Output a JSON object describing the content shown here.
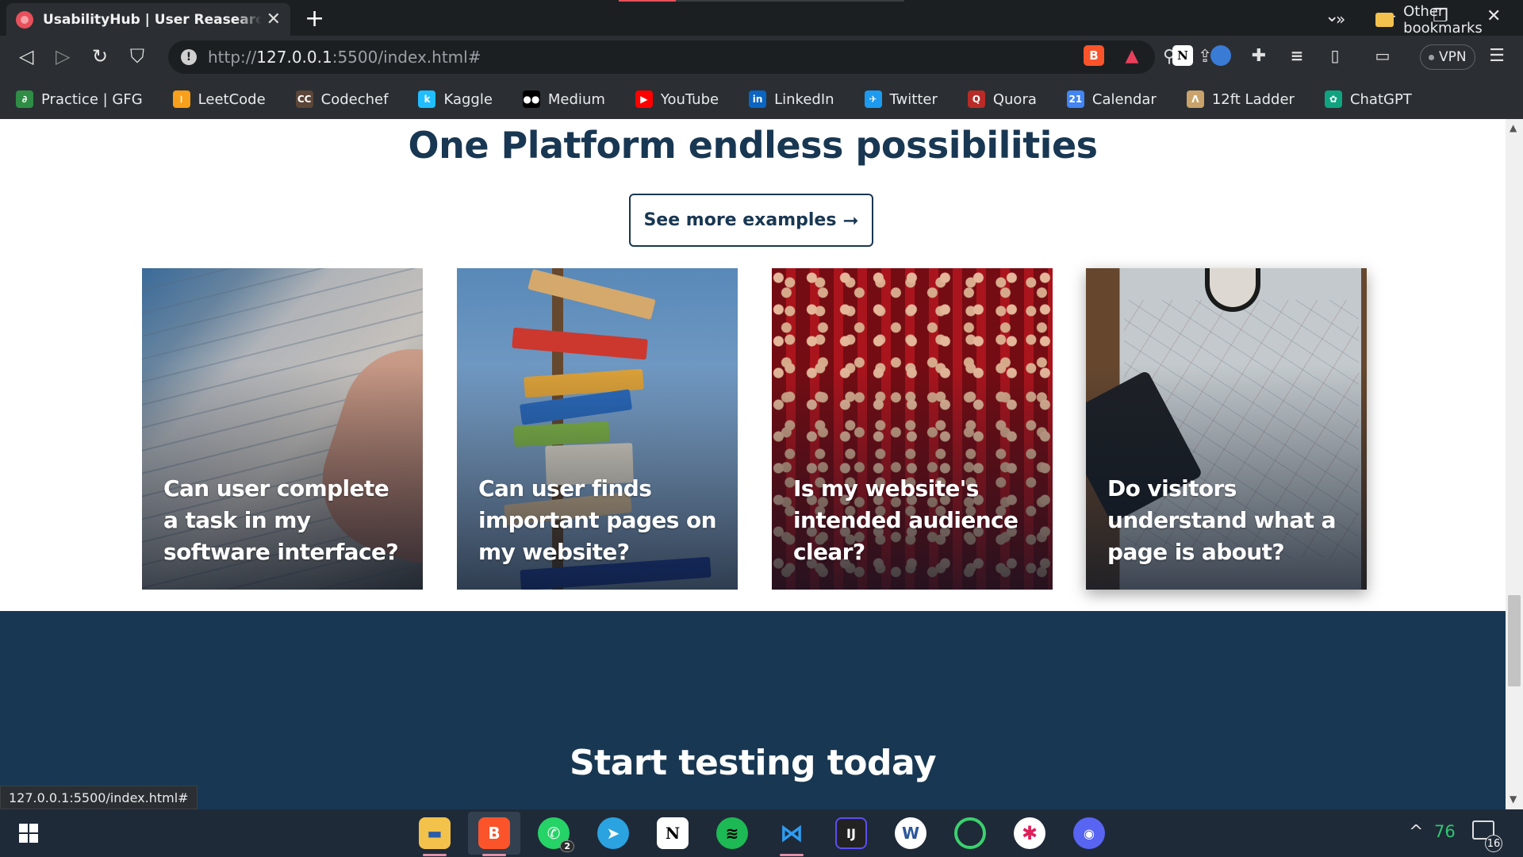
{
  "browser": {
    "tab_title": "UsabilityHub | User Reasearch & U",
    "url_host": "127.0.0.1",
    "url_prefix": "http://",
    "url_suffix": ":5500/index.html#",
    "vpn_label": "VPN",
    "status_url": "127.0.0.1:5500/index.html#"
  },
  "bookmarks": {
    "items": [
      {
        "label": "Practice | GFG",
        "icon": "gfg-icon",
        "color": "#2f8d46"
      },
      {
        "label": "LeetCode",
        "icon": "leetcode-icon",
        "color": "#f89f1b"
      },
      {
        "label": "Codechef",
        "icon": "codechef-icon",
        "color": "#5b4638"
      },
      {
        "label": "Kaggle",
        "icon": "kaggle-icon",
        "color": "#20beff"
      },
      {
        "label": "Medium",
        "icon": "medium-icon",
        "color": "#000000"
      },
      {
        "label": "YouTube",
        "icon": "youtube-icon",
        "color": "#ff0000"
      },
      {
        "label": "LinkedIn",
        "icon": "linkedin-icon",
        "color": "#0a66c2"
      },
      {
        "label": "Twitter",
        "icon": "twitter-icon",
        "color": "#1d9bf0"
      },
      {
        "label": "Quora",
        "icon": "quora-icon",
        "color": "#b92b27"
      },
      {
        "label": "Calendar",
        "icon": "calendar-icon",
        "color": "#4285f4"
      },
      {
        "label": "12ft Ladder",
        "icon": "ladder-icon",
        "color": "#c9a36b"
      },
      {
        "label": "ChatGPT",
        "icon": "chatgpt-icon",
        "color": "#10a37f"
      }
    ],
    "more_label": "»",
    "other_label": "Other bookmarks"
  },
  "page": {
    "heading": "One Platform endless possibilities",
    "cta_label": "See more examples",
    "cta_arrow": "➞",
    "cards": [
      {
        "text": "Can user complete a task in my software interface?"
      },
      {
        "text": "Can user finds important pages on my website?"
      },
      {
        "text": "Is my website's intended audience clear?"
      },
      {
        "text": "Do visitors understand what a page is about?"
      }
    ],
    "section_title": "Start testing today"
  },
  "taskbar": {
    "apps": [
      "file-explorer-icon",
      "brave-icon",
      "whatsapp-icon",
      "telegram-icon",
      "notion-icon",
      "spotify-icon",
      "vscode-icon",
      "intellij-icon",
      "word-icon",
      "circle-app-icon",
      "slack-icon",
      "discord-icon"
    ],
    "whatsapp_badge": "2",
    "tray_number": "76",
    "notification_count": "16"
  }
}
